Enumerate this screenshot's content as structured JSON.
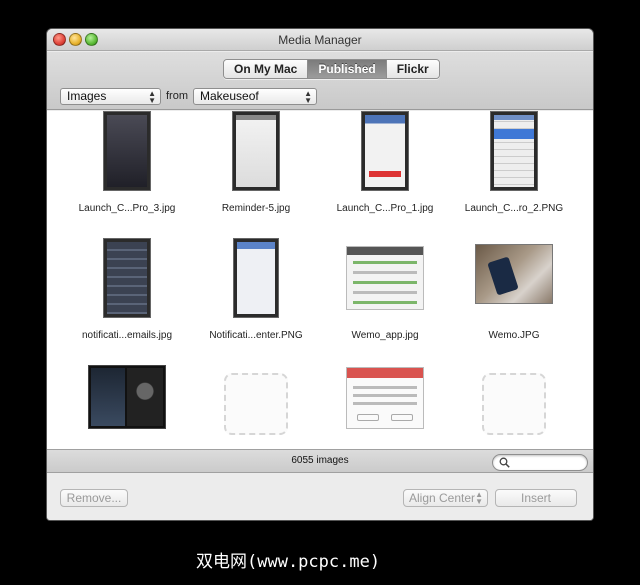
{
  "window": {
    "title": "Media Manager"
  },
  "tabs": [
    {
      "label": "On My Mac",
      "active": false
    },
    {
      "label": "Published",
      "active": true
    },
    {
      "label": "Flickr",
      "active": false
    }
  ],
  "filter": {
    "type_value": "Images",
    "from_label": "from",
    "source_value": "Makeuseof"
  },
  "grid": {
    "items": [
      {
        "label": "Launch_C...Pro_3.jpg",
        "icon": "phone-screenshot"
      },
      {
        "label": "Reminder-5.jpg",
        "icon": "phone-screenshot"
      },
      {
        "label": "Launch_C...Pro_1.jpg",
        "icon": "phone-screenshot"
      },
      {
        "label": "Launch_C...ro_2.PNG",
        "icon": "phone-screenshot"
      },
      {
        "label": "notificati...emails.jpg",
        "icon": "phone-screenshot"
      },
      {
        "label": "Notificati...enter.PNG",
        "icon": "settings-screenshot"
      },
      {
        "label": "Wemo_app.jpg",
        "icon": "app-screenshot"
      },
      {
        "label": "Wemo.JPG",
        "icon": "photo"
      },
      {
        "label": "",
        "icon": "phone-screenshot"
      },
      {
        "label": "",
        "icon": "placeholder"
      },
      {
        "label": "",
        "icon": "dialog-screenshot"
      },
      {
        "label": "",
        "icon": "placeholder"
      }
    ]
  },
  "status": {
    "count_text": "6055 images",
    "search_placeholder": ""
  },
  "buttons": {
    "remove": "Remove...",
    "align": "Align Center",
    "insert": "Insert"
  },
  "watermark": "双电网(www.pcpc.me)",
  "colors": {
    "active_tab": "#8a8a8a",
    "window_bg": "#ececec",
    "grid_bg": "#ffffff"
  }
}
